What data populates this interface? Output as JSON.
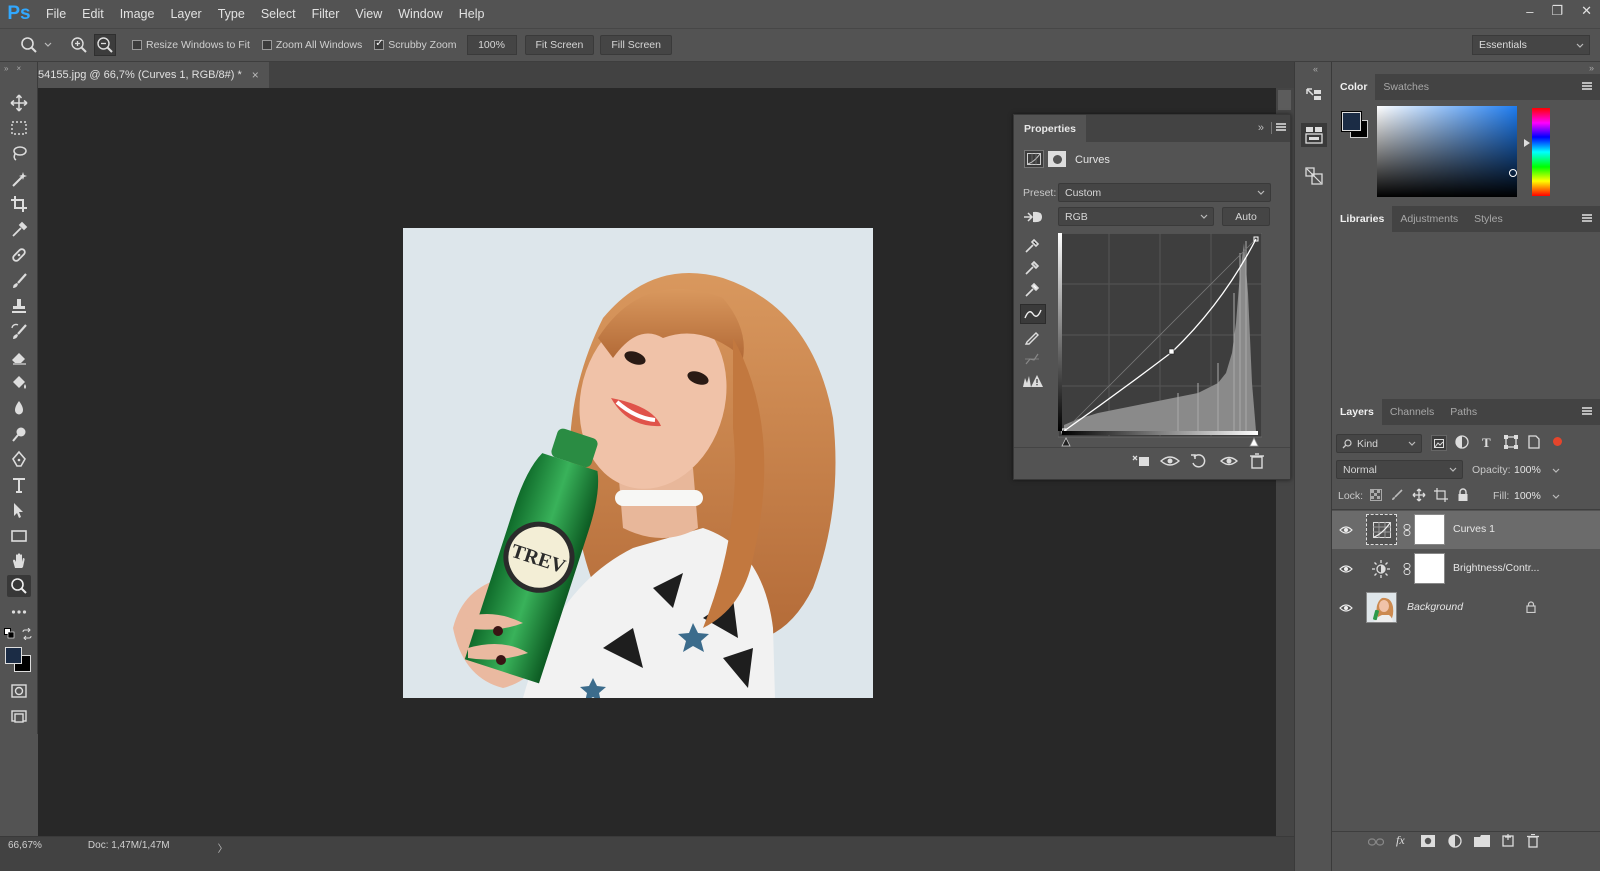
{
  "app": {
    "logo": "Ps"
  },
  "menu": [
    "File",
    "Edit",
    "Image",
    "Layer",
    "Type",
    "Select",
    "Filter",
    "View",
    "Window",
    "Help"
  ],
  "window_controls": [
    "–",
    "❐",
    "✕"
  ],
  "options": {
    "resize_windows": "Resize Windows to Fit",
    "zoom_all": "Zoom All Windows",
    "scrubby_zoom": "Scrubby Zoom",
    "zoom_value": "100%",
    "fit_screen": "Fit Screen",
    "fill_screen": "Fill Screen",
    "workspace": "Essentials",
    "checks": {
      "resize_windows": false,
      "zoom_all": false,
      "scrubby_zoom": true
    }
  },
  "document": {
    "tab_title": "54155.jpg @ 66,7% (Curves 1, RGB/8#) *",
    "close": "×"
  },
  "status": {
    "zoom": "66,67%",
    "doc": "Doc: 1,47M/1,47M",
    "arrow": "〉"
  },
  "properties": {
    "tab": "Properties",
    "adjustment": "Curves",
    "preset_label": "Preset:",
    "preset_value": "Custom",
    "channel": "RGB",
    "auto": "Auto"
  },
  "color_panel": {
    "tabs": [
      "Color",
      "Swatches"
    ],
    "foreground": "#1b2c45",
    "background": "#000000"
  },
  "libraries_panel": {
    "tabs": [
      "Libraries",
      "Adjustments",
      "Styles"
    ]
  },
  "layers_panel": {
    "tabs": [
      "Layers",
      "Channels",
      "Paths"
    ],
    "filter_kind": "Kind",
    "blend_mode": "Normal",
    "opacity_label": "Opacity:",
    "opacity": "100%",
    "lock_label": "Lock:",
    "fill_label": "Fill:",
    "fill": "100%",
    "layers": [
      {
        "name": "Curves 1",
        "selected": true
      },
      {
        "name": "Brightness/Contr...",
        "selected": false
      },
      {
        "name": "Background",
        "selected": false
      }
    ]
  }
}
